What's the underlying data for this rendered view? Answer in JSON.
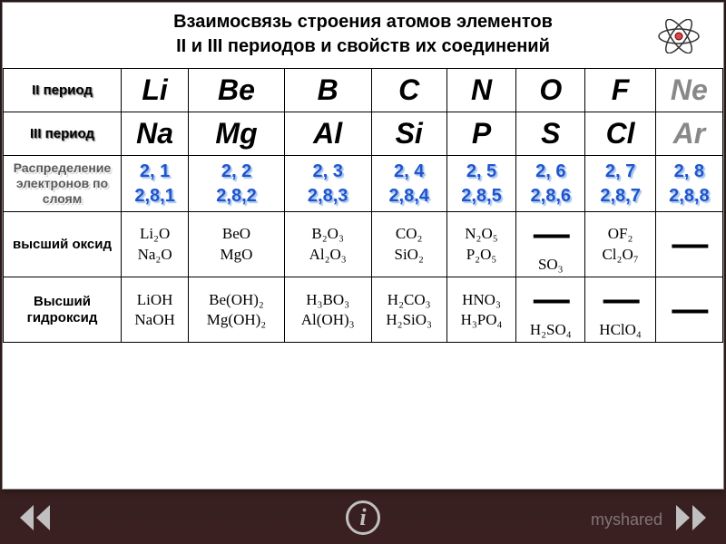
{
  "title": {
    "line1": "Взаимосвязь строения атомов элементов",
    "line2": "II и III периодов и свойств их соединений"
  },
  "rows": {
    "period2": "II период",
    "period3": "III период",
    "distribution": "Распределение электронов по слоям",
    "oxide": "высший оксид",
    "hydroxide": "Высший гидроксид"
  },
  "elements_p2": [
    "Li",
    "Be",
    "B",
    "C",
    "N",
    "O",
    "F",
    "Ne"
  ],
  "elements_p3": [
    "Na",
    "Mg",
    "Al",
    "Si",
    "P",
    "S",
    "Cl",
    "Ar"
  ],
  "dist_p2": [
    "2, 1",
    "2, 2",
    "2, 3",
    "2, 4",
    "2, 5",
    "2, 6",
    "2, 7",
    "2, 8"
  ],
  "dist_p3": [
    "2,8,1",
    "2,8,2",
    "2,8,3",
    "2,8,4",
    "2,8,5",
    "2,8,6",
    "2,8,7",
    "2,8,8"
  ],
  "oxides": [
    {
      "top": "Li₂O",
      "bot": "Na₂O"
    },
    {
      "top": "BeO",
      "bot": "MgO"
    },
    {
      "top": "B₂O₃",
      "bot": "Al₂O₃"
    },
    {
      "top": "CO₂",
      "bot": "SiO₂"
    },
    {
      "top": "N₂O₅",
      "bot": "P₂O₅"
    },
    {
      "top": "",
      "bot": "SO₃"
    },
    {
      "top": "OF₂",
      "bot": "Cl₂O₇"
    },
    {
      "top": "—",
      "bot": ""
    }
  ],
  "hydroxides": [
    {
      "top": "LiOH",
      "bot": "NaOH"
    },
    {
      "top": "Be(OH)₂",
      "bot": "Mg(OH)₂"
    },
    {
      "top": "H₃BO₃",
      "bot": "Al(OH)₃"
    },
    {
      "top": "H₂CO₃",
      "bot": "H₂SiO₃"
    },
    {
      "top": "HNO₃",
      "bot": "H₃PO₄"
    },
    {
      "top": "",
      "bot": "H₂SO₄"
    },
    {
      "top": "",
      "bot": "HClO₄"
    },
    {
      "top": "—",
      "bot": ""
    }
  ],
  "watermark": "myshared",
  "info_label": "i"
}
